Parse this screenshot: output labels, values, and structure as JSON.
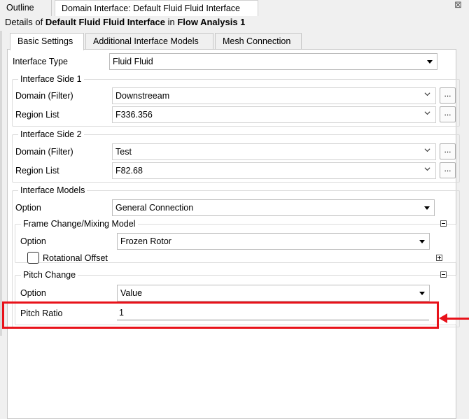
{
  "window": {
    "tabs": [
      {
        "label": "Outline"
      },
      {
        "label": "Domain Interface: Default Fluid Fluid Interface"
      }
    ],
    "close_glyph": "⊠"
  },
  "details": {
    "prefix": "Details of ",
    "object": "Default Fluid Fluid Interface",
    "middle": " in ",
    "analysis": "Flow Analysis 1"
  },
  "inner_tabs": [
    {
      "label": "Basic Settings"
    },
    {
      "label": "Additional Interface Models"
    },
    {
      "label": "Mesh Connection"
    }
  ],
  "interface_type": {
    "label": "Interface Type",
    "value": "Fluid Fluid"
  },
  "side1": {
    "title": "Interface Side 1",
    "domain_label": "Domain (Filter)",
    "domain_value": "Downstreeam",
    "region_label": "Region List",
    "region_value": "F336.356",
    "ellipsis": "..."
  },
  "side2": {
    "title": "Interface Side 2",
    "domain_label": "Domain (Filter)",
    "domain_value": "Test",
    "region_label": "Region List",
    "region_value": "F82.68",
    "ellipsis": "..."
  },
  "models": {
    "title": "Interface Models",
    "option_label": "Option",
    "option_value": "General Connection",
    "frame": {
      "title": "Frame Change/Mixing Model",
      "option_label": "Option",
      "option_value": "Frozen Rotor",
      "rotational_offset_label": "Rotational Offset"
    },
    "pitch": {
      "title": "Pitch Change",
      "option_label": "Option",
      "option_value": "Value",
      "ratio_label": "Pitch Ratio",
      "ratio_value": "1"
    }
  },
  "annotation": {
    "color": "#e8121a"
  }
}
